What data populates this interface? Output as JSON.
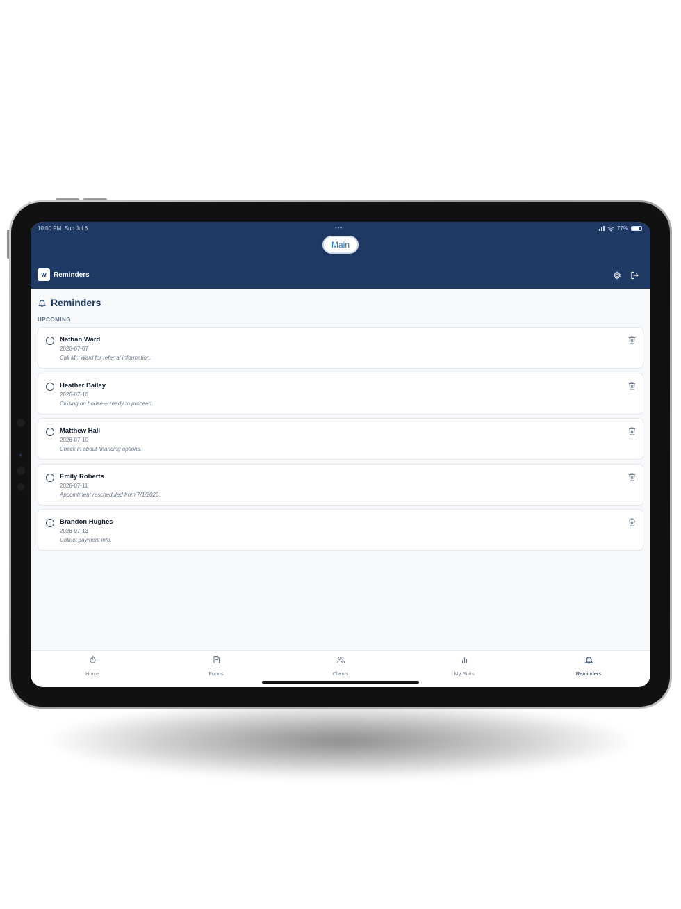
{
  "status_bar": {
    "time": "10:00 PM",
    "date": "Sun Jul 6",
    "battery": "77%"
  },
  "header": {
    "pill_label": "Main",
    "logo_text": "W",
    "title": "Reminders"
  },
  "page": {
    "heading": "Reminders",
    "section_label": "UPCOMING"
  },
  "reminders": [
    {
      "name": "Nathan Ward",
      "date": "2026-07-07",
      "note": "Call Mr. Ward for referral information."
    },
    {
      "name": "Heather Bailey",
      "date": "2026-07-10",
      "note": "Closing on house— ready to proceed."
    },
    {
      "name": "Matthew Hall",
      "date": "2026-07-10",
      "note": "Check in about financing options."
    },
    {
      "name": "Emily Roberts",
      "date": "2026-07-11",
      "note": "Appointment rescheduled from 7/1/2026."
    },
    {
      "name": "Brandon Hughes",
      "date": "2026-07-13",
      "note": "Collect payment info."
    }
  ],
  "tabs": [
    {
      "label": "Home",
      "icon": "home-icon"
    },
    {
      "label": "Forms",
      "icon": "document-icon"
    },
    {
      "label": "Clients",
      "icon": "users-icon"
    },
    {
      "label": "My Stats",
      "icon": "bar-chart-icon"
    },
    {
      "label": "Reminders",
      "icon": "bell-icon",
      "active": true
    }
  ],
  "colors": {
    "header_bg": "#1e3a64",
    "accent": "#1e6fd0",
    "page_bg": "#f7f8fa"
  }
}
